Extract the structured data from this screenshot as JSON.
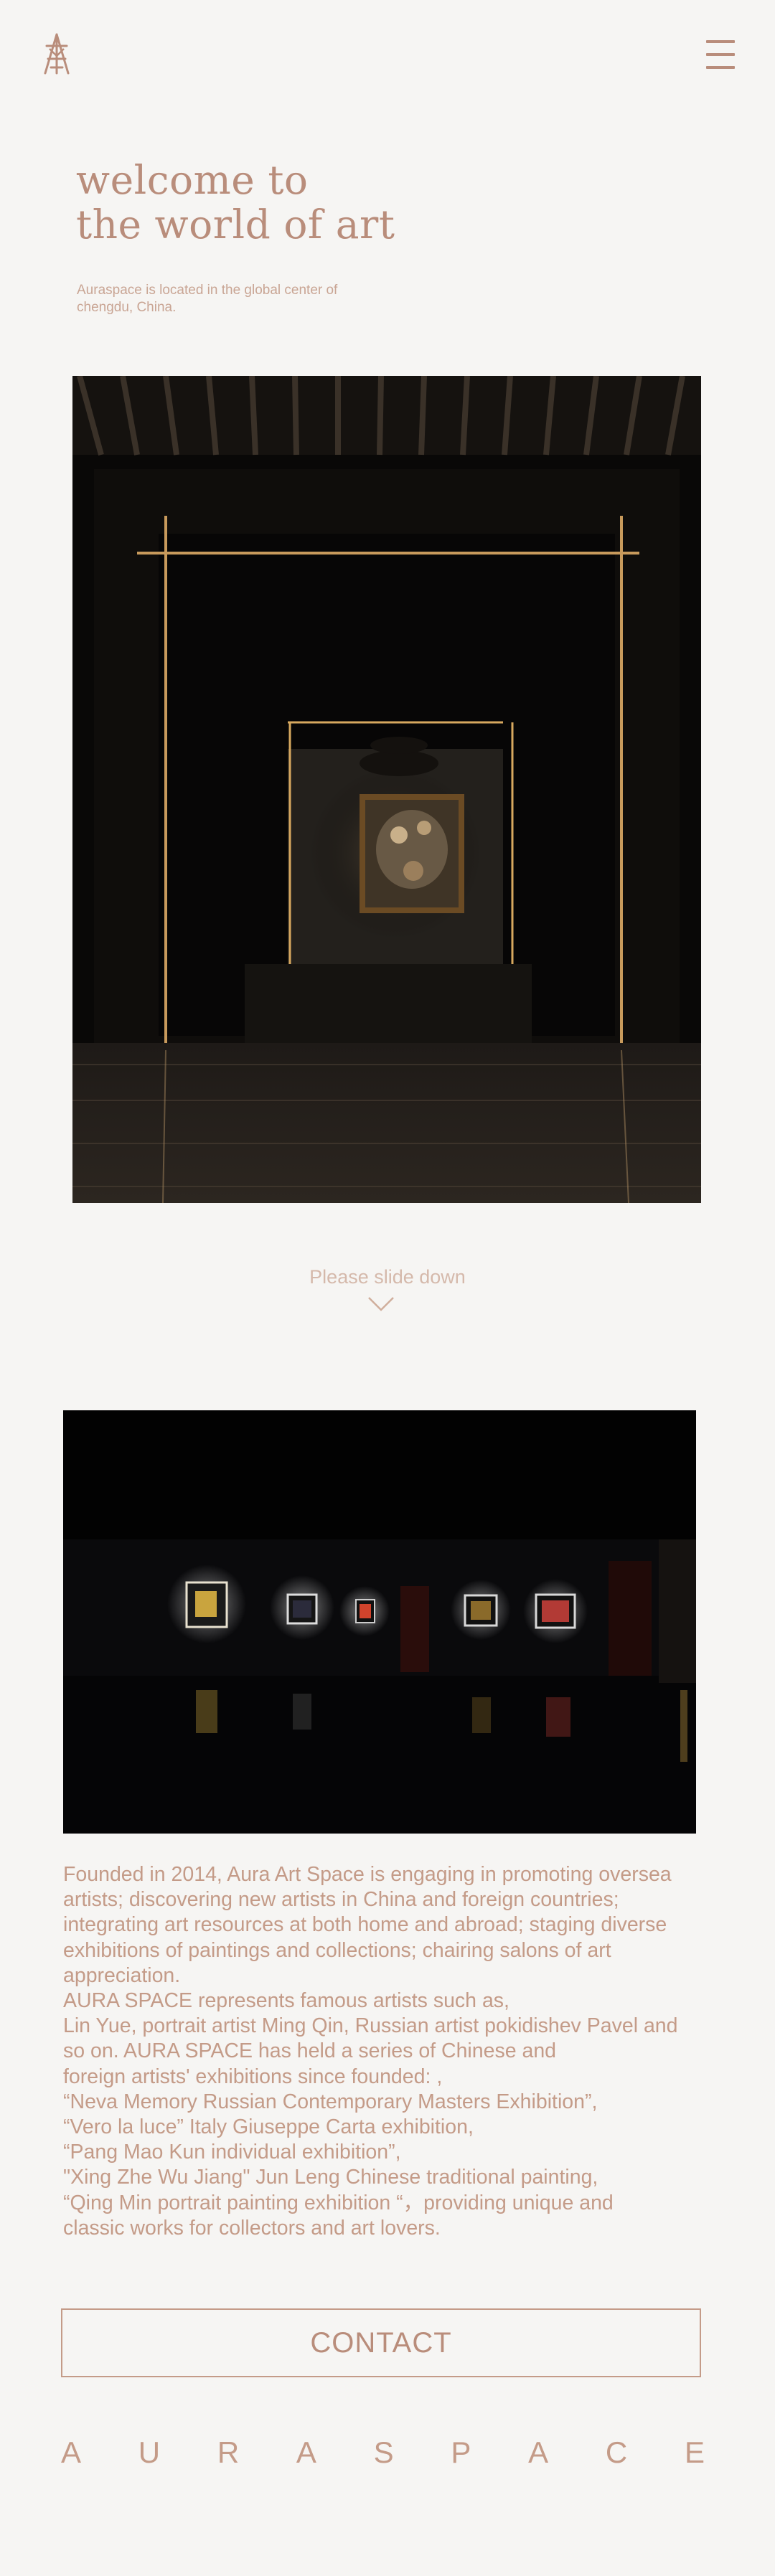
{
  "header": {
    "logo_icon": "aura-space-monogram-icon",
    "menu_icon": "hamburger-menu-icon"
  },
  "hero": {
    "title": "welcome to\nthe world of art",
    "subtitle": "Auraspace is located in the global center of chengdu, China."
  },
  "scroll_hint": {
    "label": "Please slide down",
    "icon": "chevron-down-icon"
  },
  "about": {
    "lines": [
      "Founded in 2014, Aura Art Space is engaging in promoting oversea",
      "artists; discovering new artists in China and foreign countries;",
      "integrating art resources at both home and abroad; staging diverse",
      "exhibitions of paintings and collections; chairing salons of art",
      "appreciation.",
      "AURA SPACE represents famous artists such as,",
      "Lin Yue, portrait artist Ming Qin, Russian artist pokidishev Pavel and",
      "so on. AURA SPACE has held a series of Chinese and",
      "foreign artists' exhibitions since founded: ,",
      "“Neva Memory Russian Contemporary Masters Exhibition”,",
      "“Vero la luce” Italy Giuseppe Carta exhibition,",
      "“Pang Mao Kun individual exhibition”,",
      "\"Xing Zhe Wu Jiang\" Jun Leng Chinese traditional painting,",
      "“Qing Min portrait painting exhibition “，providing unique and",
      "classic works for collectors and art lovers."
    ]
  },
  "contact": {
    "label": "CONTACT"
  },
  "brand": {
    "letters": [
      "A",
      "U",
      "R",
      "A",
      "S",
      "P",
      "A",
      "C",
      "E"
    ]
  },
  "colors": {
    "background": "#f6f5f3",
    "accent": "#b98d7b"
  }
}
